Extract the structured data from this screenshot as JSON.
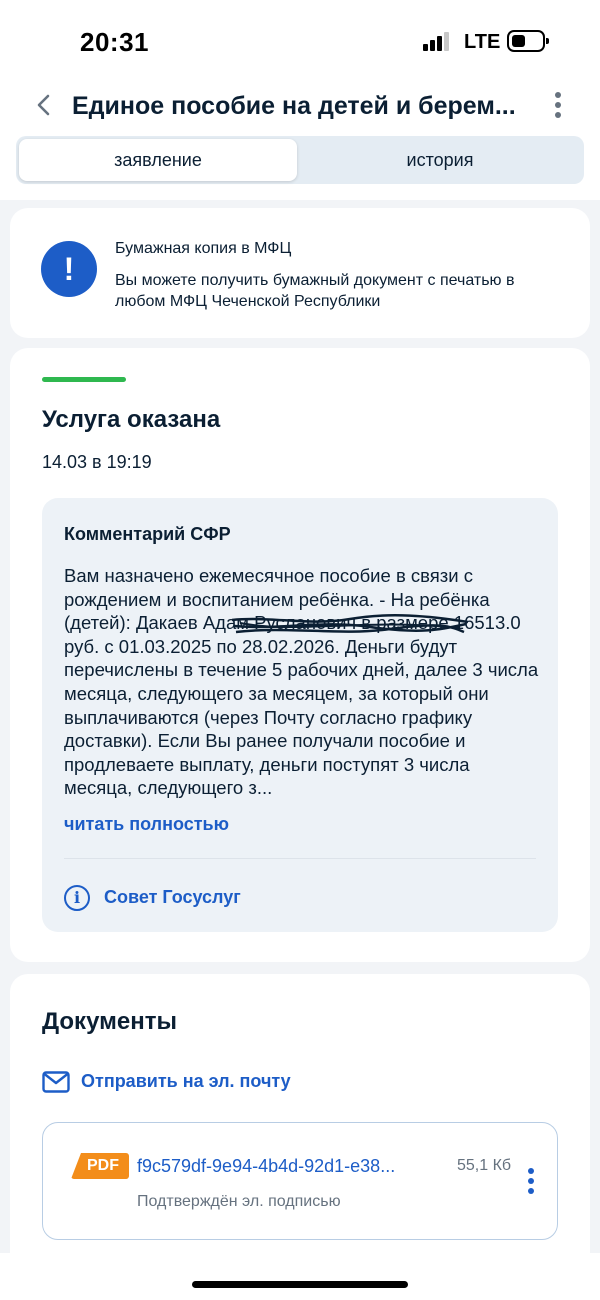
{
  "status_bar": {
    "time": "20:31",
    "network": "LTE"
  },
  "header": {
    "title": "Единое пособие на детей и берем...",
    "back_icon": "chevron-left-icon",
    "menu_icon": "more-vertical-icon"
  },
  "tabs": [
    {
      "label": "заявление",
      "active": true
    },
    {
      "label": "история",
      "active": false
    }
  ],
  "info_card": {
    "icon": "exclamation-icon",
    "title": "Бумажная копия в МФЦ",
    "text": "Вы можете получить бумажный документ с печатью в любом МФЦ Чеченской Республики"
  },
  "status_card": {
    "progress_color": "#2fb84f",
    "title": "Услуга оказана",
    "date": "14.03 в 19:19",
    "comment": {
      "title": "Комментарий СФР",
      "text": "Вам назначено ежемесячное пособие в связи с рождением и воспитанием ребёнка. - На ребёнка (детей): Дакаев Адам Русланович в размере 16513.0 руб. с 01.03.2025 по 28.02.2026. Деньги будут перечислены в течение 5 рабочих дней, далее 3 числа месяца, следующего за месяцем, за который они выплачиваются (через Почту согласно графику доставки). Если Вы ранее получали пособие и продлеваете выплату, деньги поступят 3 числа месяца, следующего з...",
      "read_more": "читать полностью",
      "advice_label": "Совет Госуслуг"
    }
  },
  "documents": {
    "title": "Документы",
    "send_email": "Отправить на эл. почту",
    "files": [
      {
        "type": "PDF",
        "name": "f9c579df-9e94-4b4d-92d1-e38...",
        "size": "55,1 Кб",
        "subtitle": "Подтверждён эл. подписью"
      }
    ]
  },
  "colors": {
    "accent": "#1d5dc7",
    "success": "#2fb84f",
    "pdf_badge": "#f38d1a"
  }
}
